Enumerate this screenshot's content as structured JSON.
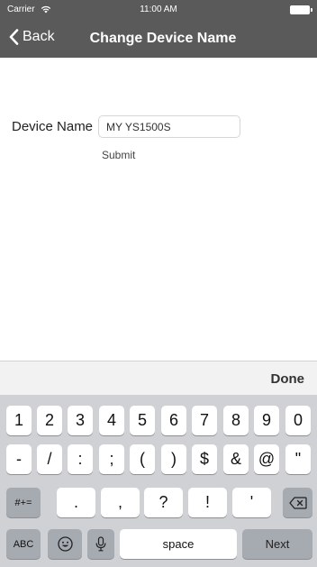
{
  "status_bar": {
    "carrier": "Carrier",
    "time": "11:00 AM"
  },
  "nav": {
    "back_label": "Back",
    "title": "Change Device Name"
  },
  "form": {
    "device_label": "Device Name",
    "device_value": "MY YS1500S",
    "submit_label": "Submit"
  },
  "accessory": {
    "done_label": "Done"
  },
  "keyboard": {
    "row1": [
      "1",
      "2",
      "3",
      "4",
      "5",
      "6",
      "7",
      "8",
      "9",
      "0"
    ],
    "row2": [
      "-",
      "/",
      ":",
      ";",
      "(",
      ")",
      "$",
      "&",
      "@",
      "\""
    ],
    "row3": [
      ".",
      ",",
      "?",
      "!",
      "'"
    ],
    "symbols_label": "#+=",
    "abc_label": "ABC",
    "space_label": "space",
    "next_label": "Next"
  }
}
